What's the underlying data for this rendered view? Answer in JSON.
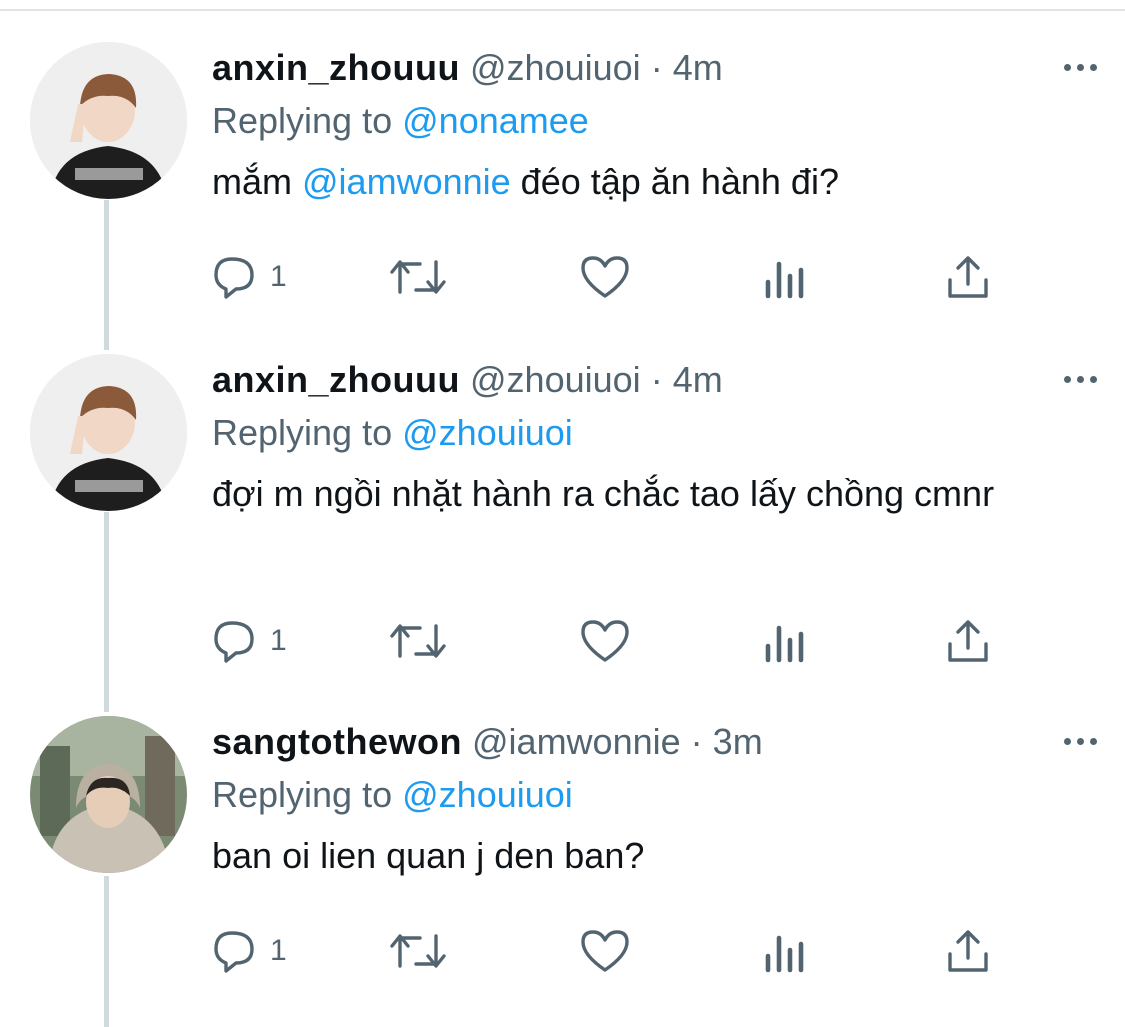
{
  "tweets": [
    {
      "display_name": "anxin_zhouuu",
      "handle": "@zhouiuoi",
      "separator": "·",
      "time": "4m",
      "replying_label": "Replying to",
      "replying_to": "@nonamee",
      "text_before": "mắm",
      "text_mention": "@iamwonnie",
      "text_after": "đéo tập ăn hành đi?",
      "reply_count": "1",
      "avatar": "person-peace-sign-black-hoodie"
    },
    {
      "display_name": "anxin_zhouuu",
      "handle": "@zhouiuoi",
      "separator": "·",
      "time": "4m",
      "replying_label": "Replying to",
      "replying_to": "@zhouiuoi",
      "text": "đợi m ngồi nhặt hành ra chắc tao lấy chồng cmnr",
      "reply_count": "1",
      "avatar": "person-peace-sign-black-hoodie"
    },
    {
      "display_name": "sangtothewon",
      "handle": "@iamwonnie",
      "separator": "·",
      "time": "3m",
      "replying_label": "Replying to",
      "replying_to": "@zhouiuoi",
      "text": "ban oi lien quan j den ban?",
      "reply_count": "1",
      "avatar": "person-beige-hooded-jacket"
    }
  ],
  "icons": [
    "reply-icon",
    "retweet-icon",
    "like-icon",
    "analytics-icon",
    "share-icon",
    "more-icon"
  ],
  "colors": {
    "accent": "#1d9bf0",
    "secondary_text": "#536471",
    "primary_text": "#0f1419",
    "thread_line": "#cfd9de"
  }
}
